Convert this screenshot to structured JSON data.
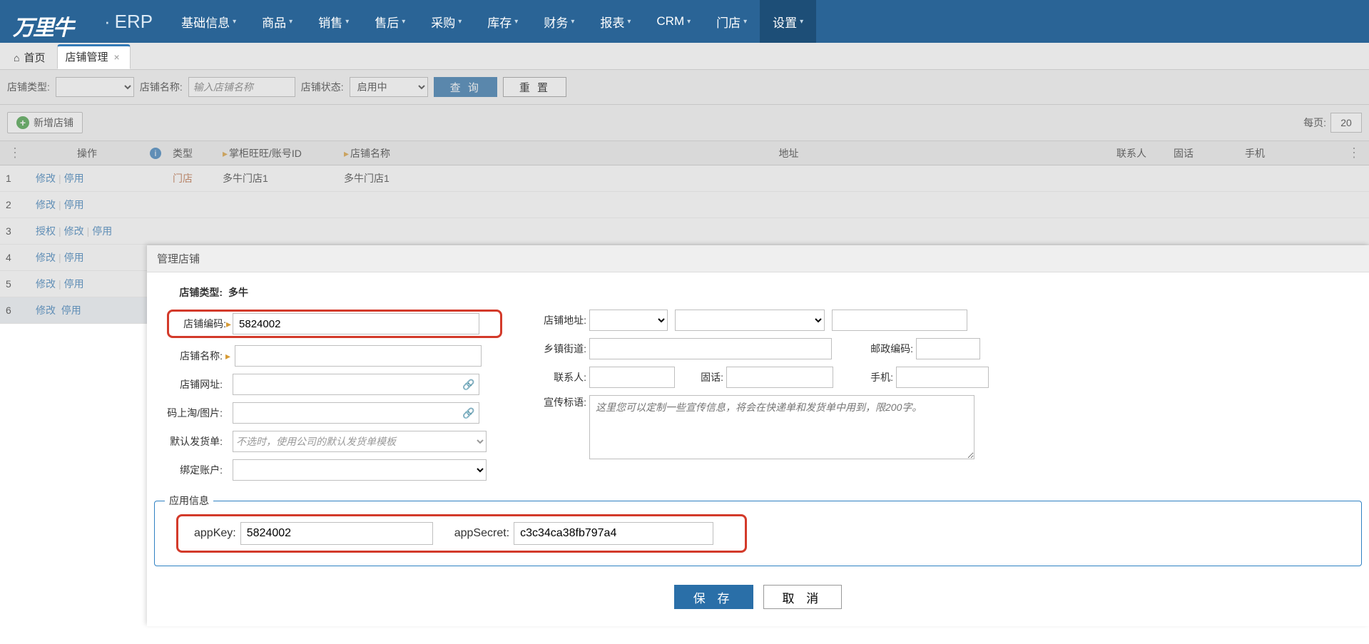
{
  "brand": {
    "suffix": "ERP"
  },
  "nav": {
    "items": [
      {
        "label": "基础信息"
      },
      {
        "label": "商品"
      },
      {
        "label": "销售"
      },
      {
        "label": "售后"
      },
      {
        "label": "采购"
      },
      {
        "label": "库存"
      },
      {
        "label": "财务"
      },
      {
        "label": "报表"
      },
      {
        "label": "CRM"
      },
      {
        "label": "门店"
      },
      {
        "label": "设置"
      }
    ]
  },
  "tabs": {
    "home": "首页",
    "active": "店铺管理"
  },
  "filter": {
    "type_label": "店铺类型:",
    "name_label": "店铺名称:",
    "name_placeholder": "输入店铺名称",
    "status_label": "店铺状态:",
    "status_value": "启用中",
    "query_btn": "查 询",
    "reset_btn": "重 置"
  },
  "toolbar": {
    "add_btn": "新增店铺",
    "page_label": "每页:",
    "page_size": "20"
  },
  "table": {
    "headers": {
      "op": "操作",
      "type": "类型",
      "wangwang": "掌柜旺旺/账号ID",
      "shop_name": "店铺名称",
      "address": "地址",
      "contact": "联系人",
      "tel": "固话",
      "mobile": "手机"
    },
    "row_actions": {
      "modify": "修改",
      "disable": "停用",
      "auth": "授权"
    },
    "rows": [
      {
        "idx": "1",
        "type": "门店",
        "ww": "多牛门店1",
        "name": "多牛门店1"
      },
      {
        "idx": "2"
      },
      {
        "idx": "3"
      },
      {
        "idx": "4"
      },
      {
        "idx": "5"
      },
      {
        "idx": "6"
      }
    ]
  },
  "modal": {
    "title": "管理店铺",
    "type_label": "店铺类型:",
    "type_value": "多牛",
    "code_label": "店铺编码:",
    "code_value": "5824002",
    "name_label": "店铺名称:",
    "url_label": "店铺网址:",
    "pic_label": "码上淘/图片:",
    "default_slip_label": "默认发货单:",
    "default_slip_placeholder": "不选时，使用公司的默认发货单模板",
    "bind_account_label": "绑定账户:",
    "addr_label": "店铺地址:",
    "town_label": "乡镇街道:",
    "postcode_label": "邮政编码:",
    "contact_label": "联系人:",
    "tel_label": "固话:",
    "mobile_label": "手机:",
    "slogan_label": "宣传标语:",
    "slogan_placeholder": "这里您可以定制一些宣传信息，将会在快递单和发货单中用到，限200字。",
    "app_info_legend": "应用信息",
    "appkey_label": "appKey:",
    "appkey_value": "5824002",
    "appsecret_label": "appSecret:",
    "appsecret_value": "c3c34ca38fb797a4",
    "save_btn": "保 存",
    "cancel_btn": "取 消"
  }
}
